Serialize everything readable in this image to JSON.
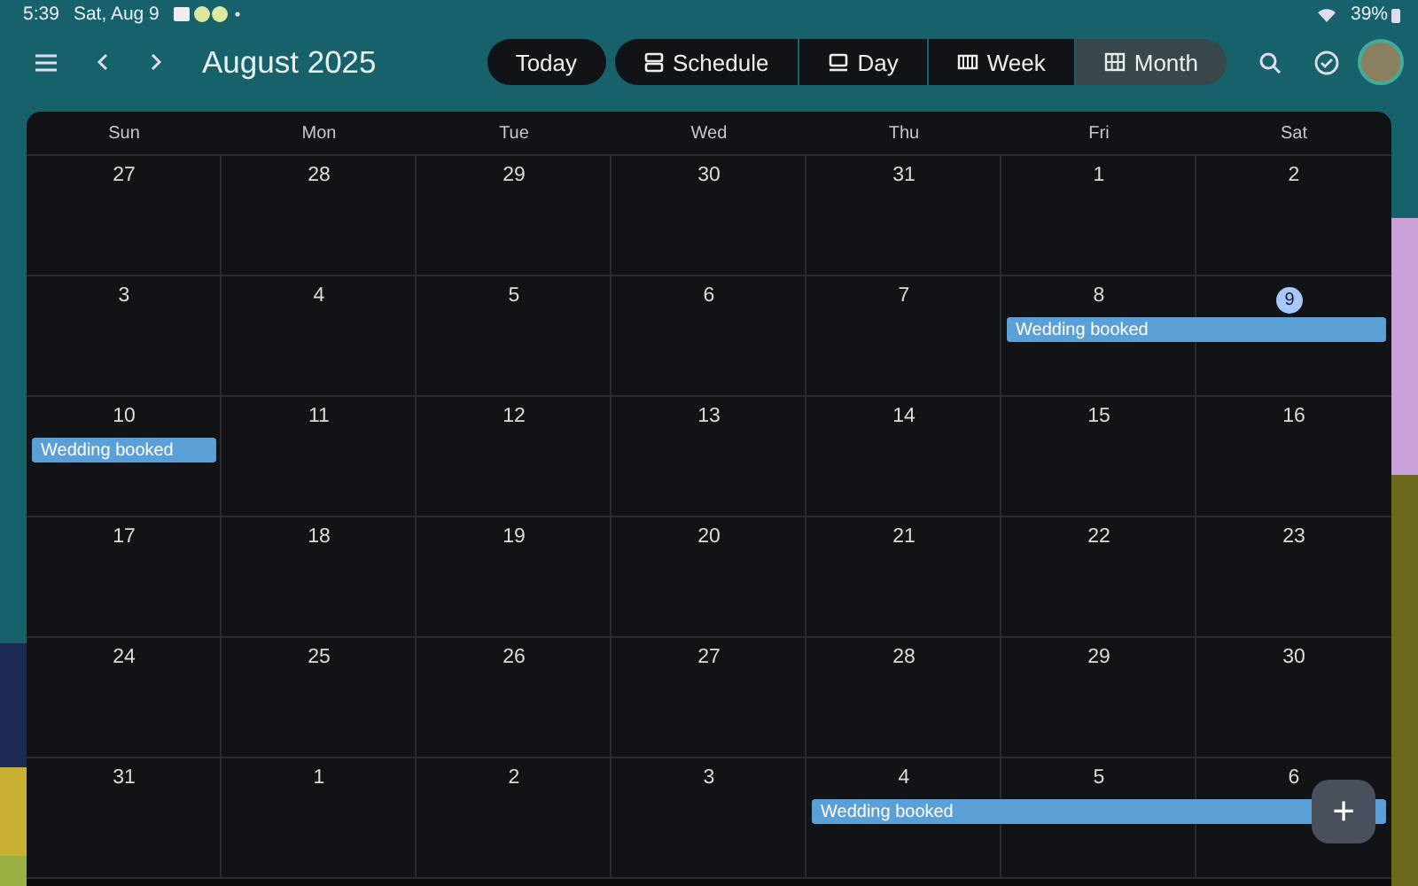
{
  "status_bar": {
    "time": "5:39",
    "date": "Sat, Aug 9",
    "battery": "39%"
  },
  "toolbar": {
    "title": "August 2025",
    "today_button": "Today",
    "views": [
      {
        "label": "Schedule",
        "kind": "schedule",
        "selected": false
      },
      {
        "label": "Day",
        "kind": "day",
        "selected": false
      },
      {
        "label": "Week",
        "kind": "week",
        "selected": false
      },
      {
        "label": "Month",
        "kind": "month",
        "selected": true
      }
    ]
  },
  "weekdays": [
    "Sun",
    "Mon",
    "Tue",
    "Wed",
    "Thu",
    "Fri",
    "Sat"
  ],
  "weeks": [
    {
      "days": [
        {
          "label": "27",
          "today": false,
          "event": false
        },
        {
          "label": "28",
          "today": false,
          "event": false
        },
        {
          "label": "29",
          "today": false,
          "event": false
        },
        {
          "label": "30",
          "today": false,
          "event": false
        },
        {
          "label": "31",
          "today": false,
          "event": false
        },
        {
          "label": "1",
          "today": false,
          "event": false
        },
        {
          "label": "2",
          "today": false,
          "event": false
        }
      ]
    },
    {
      "event_title": "Wedding booked",
      "days": [
        {
          "label": "3",
          "today": false,
          "event": false
        },
        {
          "label": "4",
          "today": false,
          "event": false
        },
        {
          "label": "5",
          "today": false,
          "event": false
        },
        {
          "label": "6",
          "today": false,
          "event": false
        },
        {
          "label": "7",
          "today": false,
          "event": false
        },
        {
          "label": "8",
          "today": false,
          "event": true
        },
        {
          "label": "9",
          "today": true,
          "event": true
        }
      ]
    },
    {
      "event_title": "Wedding booked",
      "days": [
        {
          "label": "10",
          "today": false,
          "event": true
        },
        {
          "label": "11",
          "today": false,
          "event": false
        },
        {
          "label": "12",
          "today": false,
          "event": false
        },
        {
          "label": "13",
          "today": false,
          "event": false
        },
        {
          "label": "14",
          "today": false,
          "event": false
        },
        {
          "label": "15",
          "today": false,
          "event": false
        },
        {
          "label": "16",
          "today": false,
          "event": false
        }
      ]
    },
    {
      "days": [
        {
          "label": "17",
          "today": false,
          "event": false
        },
        {
          "label": "18",
          "today": false,
          "event": false
        },
        {
          "label": "19",
          "today": false,
          "event": false
        },
        {
          "label": "20",
          "today": false,
          "event": false
        },
        {
          "label": "21",
          "today": false,
          "event": false
        },
        {
          "label": "22",
          "today": false,
          "event": false
        },
        {
          "label": "23",
          "today": false,
          "event": false
        }
      ]
    },
    {
      "days": [
        {
          "label": "24",
          "today": false,
          "event": false
        },
        {
          "label": "25",
          "today": false,
          "event": false
        },
        {
          "label": "26",
          "today": false,
          "event": false
        },
        {
          "label": "27",
          "today": false,
          "event": false
        },
        {
          "label": "28",
          "today": false,
          "event": false
        },
        {
          "label": "29",
          "today": false,
          "event": false
        },
        {
          "label": "30",
          "today": false,
          "event": false
        }
      ]
    },
    {
      "event_title": "Wedding booked",
      "days": [
        {
          "label": "31",
          "today": false,
          "event": false
        },
        {
          "label": "1",
          "today": false,
          "event": false
        },
        {
          "label": "2",
          "today": false,
          "event": false
        },
        {
          "label": "3",
          "today": false,
          "event": false
        },
        {
          "label": "4",
          "today": false,
          "event": true
        },
        {
          "label": "5",
          "today": false,
          "event": true
        },
        {
          "label": "6",
          "today": false,
          "event": true
        }
      ]
    }
  ],
  "fab": "+"
}
